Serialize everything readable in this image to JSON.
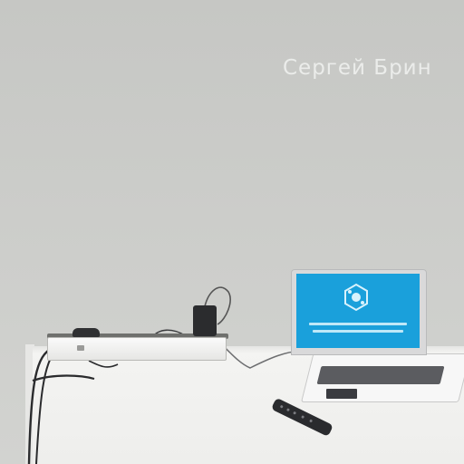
{
  "wall": {
    "sign_text": "Сергей Брин"
  },
  "objects": {
    "laptop": "laptop",
    "power_strip": "power-strip",
    "remote": "tv-remote",
    "adapter": "power-adapter"
  },
  "colors": {
    "wall": "#c9cac7",
    "table": "#f2f2f0",
    "screen": "#1aa0db",
    "cable": "#2a2b2d"
  }
}
